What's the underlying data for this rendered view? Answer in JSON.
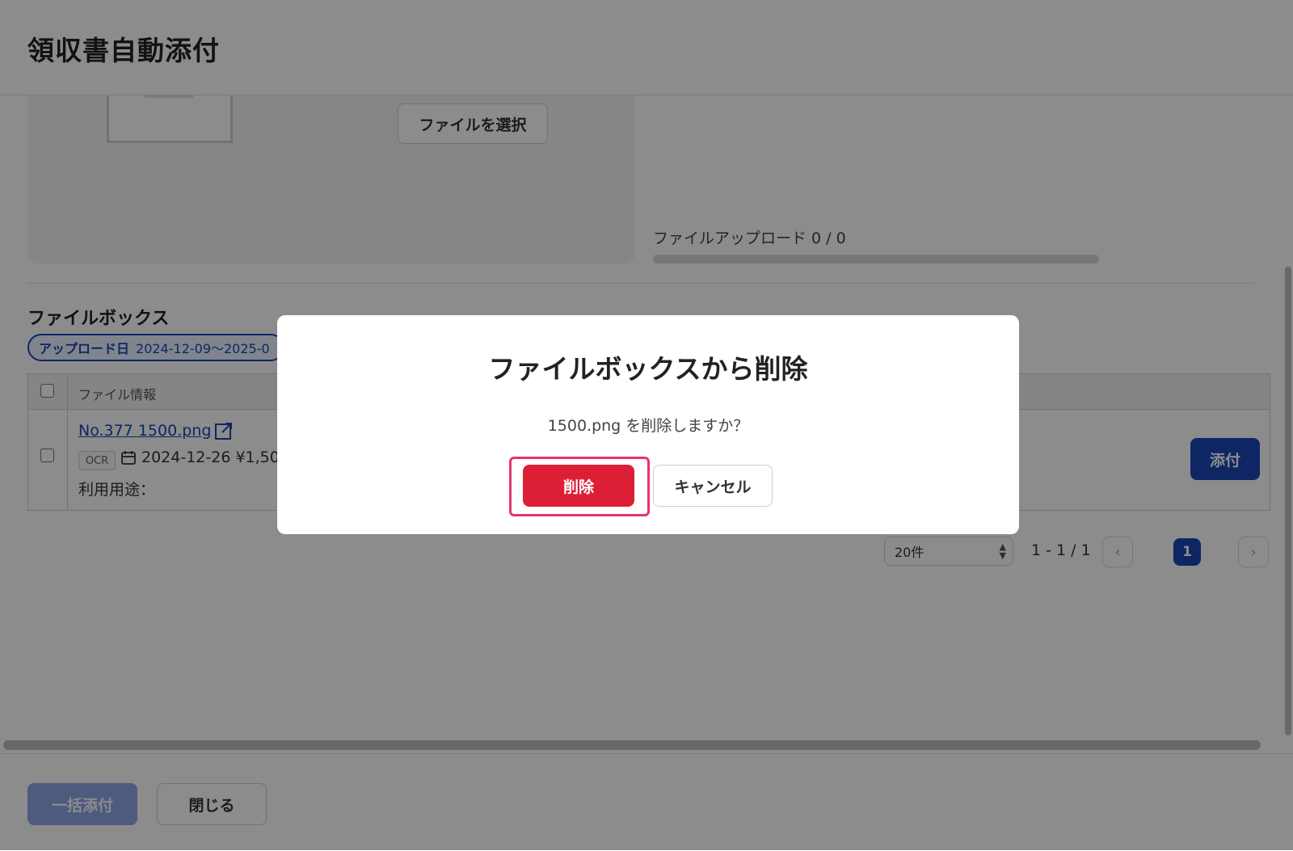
{
  "header": {
    "title": "領収書自動添付"
  },
  "upload": {
    "select_button": "ファイルを選択",
    "progress_label": "ファイルアップロード 0 / 0",
    "progress_fraction": 0
  },
  "filebox": {
    "title": "ファイルボックス",
    "filter_chip": {
      "label": "アップロード日",
      "value": "2024-12-09〜2025-0"
    },
    "table": {
      "header": "ファイル情報",
      "rows": [
        {
          "file_name": "No.377 1500.png",
          "tag": "OCR",
          "meta": "2024-12-26 ¥1,50",
          "usage": "利用用途：",
          "attach_button": "添付"
        }
      ]
    },
    "pagination": {
      "per_page": "20件",
      "range": "1 - 1 / 1",
      "prev": "‹",
      "current_page": "1",
      "next": "›"
    }
  },
  "footer": {
    "bulk_attach": "一括添付",
    "close": "閉じる"
  },
  "modal": {
    "title": "ファイルボックスから削除",
    "message": "1500.png を削除しますか？",
    "delete_button": "削除",
    "cancel_button": "キャンセル"
  },
  "colors": {
    "primary": "#1c46b8",
    "danger": "#dc1f35",
    "highlight": "#e8336b"
  }
}
